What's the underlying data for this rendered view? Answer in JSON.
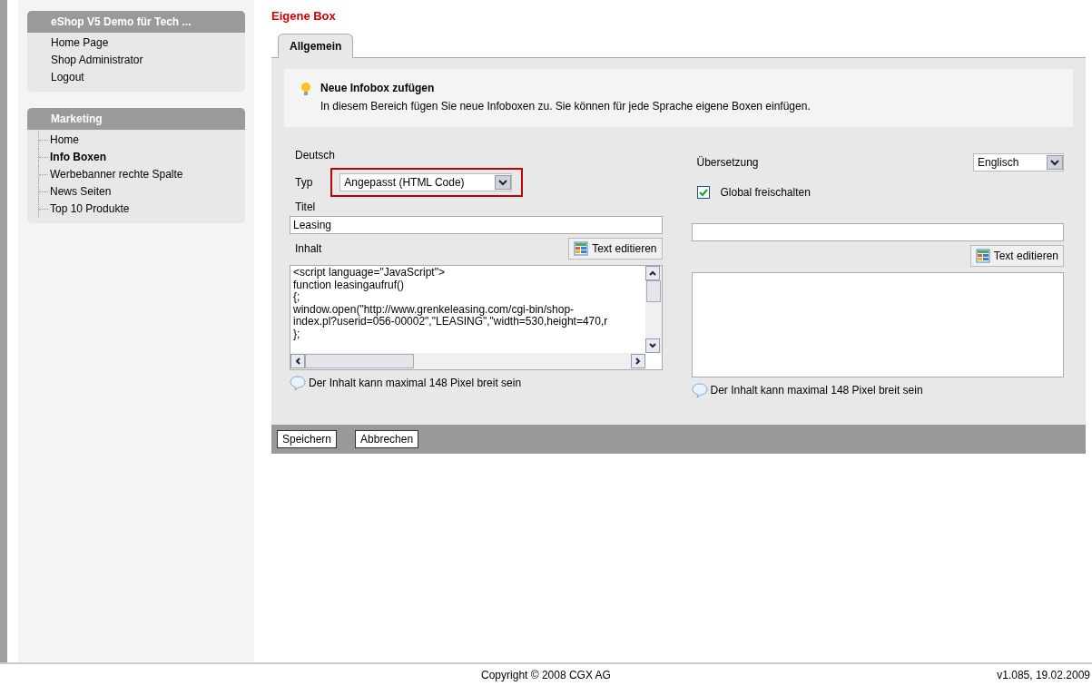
{
  "sidebar": {
    "groups": [
      {
        "title": "eShop V5 Demo für Tech ...",
        "tree": false,
        "items": [
          {
            "label": "Home Page",
            "selected": false
          },
          {
            "label": "Shop Administrator",
            "selected": false
          },
          {
            "label": "Logout",
            "selected": false
          }
        ]
      },
      {
        "title": "Marketing",
        "tree": true,
        "items": [
          {
            "label": "Home",
            "selected": false
          },
          {
            "label": "Info Boxen",
            "selected": true
          },
          {
            "label": "Werbebanner rechte Spalte",
            "selected": false
          },
          {
            "label": "News Seiten",
            "selected": false
          },
          {
            "label": "Top 10 Produkte",
            "selected": false
          }
        ]
      }
    ]
  },
  "page_title": "Eigene Box",
  "tabs": [
    {
      "label": "Allgemein",
      "selected": true
    }
  ],
  "info": {
    "title": "Neue Infobox zufügen",
    "text": "In diesem Bereich fügen Sie neue Infoboxen zu. Sie können für jede Sprache eigene Boxen einfügen."
  },
  "left": {
    "heading": "Deutsch",
    "type_label": "Typ",
    "type_value": "Angepasst (HTML Code)",
    "type_highlighted": true,
    "title_label": "Titel",
    "title_value": "Leasing",
    "content_label": "Inhalt",
    "edit_button": "Text editieren",
    "content_lines": [
      "<script language=\"JavaScript\">",
      "function leasingaufruf()",
      "{;",
      "window.open(\"http://www.grenkeleasing.com/cgi-bin/shop-",
      "index.pl?userid=056-00002\",\"LEASING\",\"width=530,height=470,r",
      "};"
    ],
    "hint": "Der Inhalt kann maximal 148 Pixel breit sein"
  },
  "right": {
    "heading": "Übersetzung",
    "language": "Englisch",
    "global_label": "Global freischalten",
    "global_checked": true,
    "edit_button": "Text editieren",
    "hint": "Der Inhalt kann maximal 148 Pixel breit sein"
  },
  "actions": [
    "Speichern",
    "Abbrechen"
  ],
  "footer": {
    "copyright": "Copyright © 2008 CGX AG",
    "version": "v1.085, 19.02.2009"
  }
}
